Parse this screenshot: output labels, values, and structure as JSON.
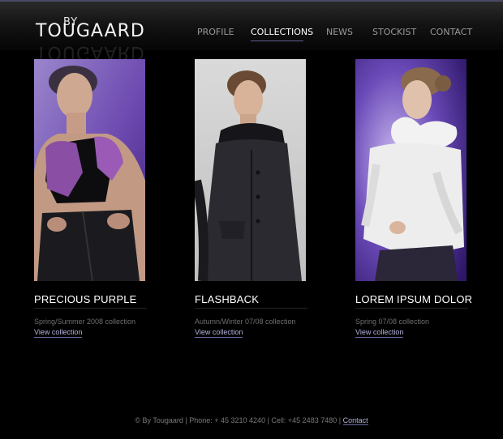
{
  "brand": {
    "by": "BY",
    "name": "TOUGAARD"
  },
  "nav": [
    {
      "label": "PROFILE",
      "active": false
    },
    {
      "label": "COLLECTIONS",
      "active": true
    },
    {
      "label": "NEWS",
      "active": false
    },
    {
      "label": "STOCKIST",
      "active": false
    },
    {
      "label": "CONTACT",
      "active": false
    }
  ],
  "collections": [
    {
      "title": "PRECIOUS PURPLE",
      "season": "Spring/Summer 2008 collection",
      "link": "View collection"
    },
    {
      "title": "FLASHBACK",
      "season": "Autumn/Winter 07/08 collection",
      "link": "View collection"
    },
    {
      "title": "LOREM IPSUM DOLOR",
      "season": "Spring 07/08 collection",
      "link": "View collection"
    }
  ],
  "footer": {
    "text": "© By Tougaard | Phone: + 45 3210 4240 | Cell: +45 2483 7480 |",
    "contact": "Contact"
  },
  "colors": {
    "accent": "#6b6b9f",
    "link": "#b4b4de",
    "background": "#000000",
    "photo1_bg": "#7b5cb3",
    "photo2_bg": "#cfcfcf",
    "photo3_bg": "#4a2f8a"
  }
}
